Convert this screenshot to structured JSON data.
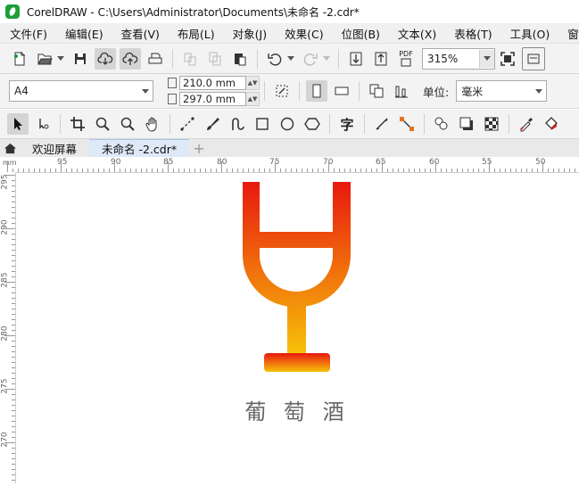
{
  "window": {
    "title": "CorelDRAW - C:\\Users\\Administrator\\Documents\\未命名 -2.cdr*"
  },
  "menu": [
    {
      "label": "文件(F)",
      "name": "menu-file"
    },
    {
      "label": "编辑(E)",
      "name": "menu-edit"
    },
    {
      "label": "查看(V)",
      "name": "menu-view"
    },
    {
      "label": "布局(L)",
      "name": "menu-layout"
    },
    {
      "label": "对象(J)",
      "name": "menu-object"
    },
    {
      "label": "效果(C)",
      "name": "menu-effects"
    },
    {
      "label": "位图(B)",
      "name": "menu-bitmaps"
    },
    {
      "label": "文本(X)",
      "name": "menu-text"
    },
    {
      "label": "表格(T)",
      "name": "menu-table"
    },
    {
      "label": "工具(O)",
      "name": "menu-tools"
    },
    {
      "label": "窗",
      "name": "menu-window"
    }
  ],
  "toolbar": {
    "zoom": "315%",
    "pdf_label": "PDF"
  },
  "property_bar": {
    "page_size": "A4",
    "width": "210.0 mm",
    "height": "297.0 mm",
    "unit_label": "单位:",
    "unit_value": "毫米"
  },
  "toolbox": {
    "text_tool_glyph": "字"
  },
  "tabs": [
    {
      "label": "欢迎屏幕",
      "active": false
    },
    {
      "label": "未命名 -2.cdr*",
      "active": true
    }
  ],
  "ruler": {
    "horizontal": [
      "95",
      "90",
      "85",
      "80",
      "75",
      "70",
      "65",
      "60",
      "55",
      "50"
    ],
    "vertical": [
      "295",
      "290",
      "285",
      "280",
      "275",
      "270"
    ]
  },
  "artwork": {
    "text": "葡 萄 酒",
    "gradient_top": "#e8180f",
    "gradient_bottom": "#f7c209",
    "text_color": "#666666"
  }
}
